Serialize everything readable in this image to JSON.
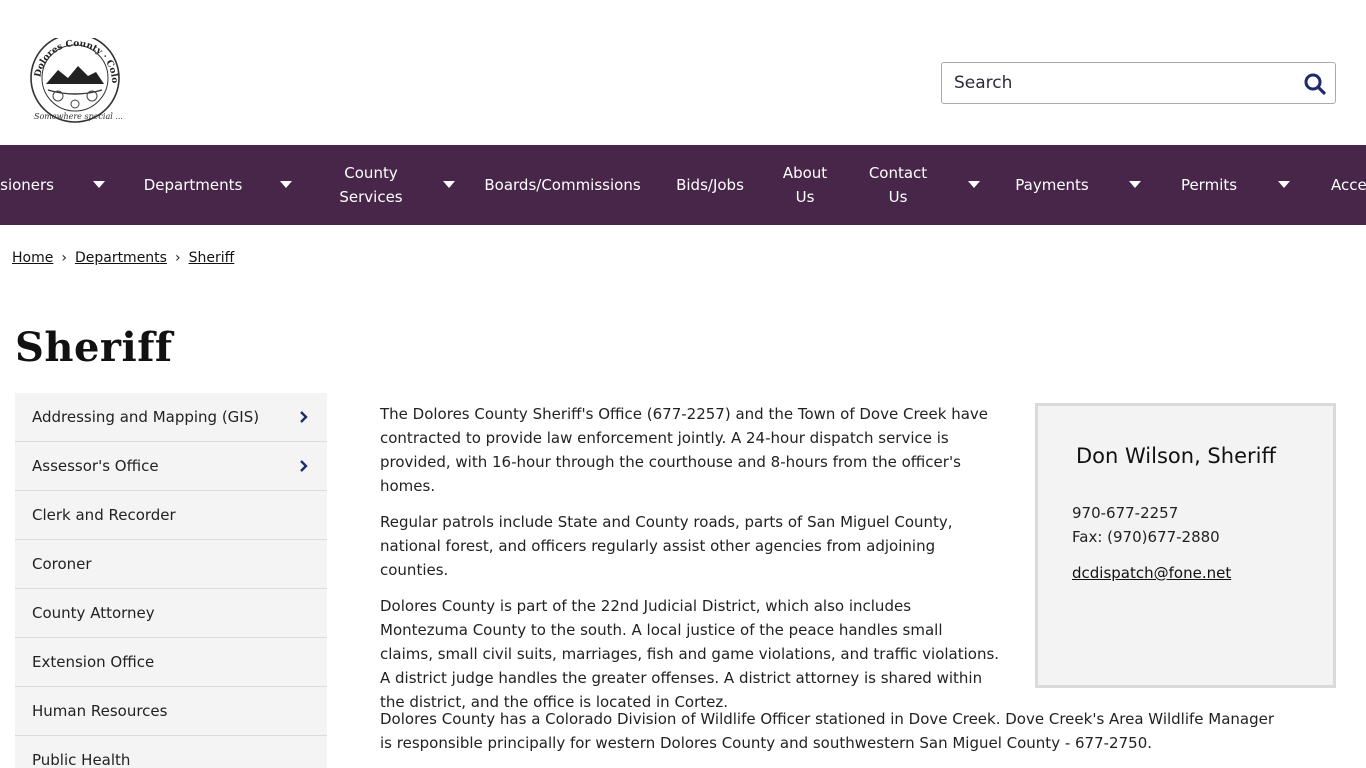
{
  "logo": {
    "seal_text": "Dolores County · Colorado",
    "tagline": "Somewhere special ..."
  },
  "search": {
    "placeholder": "Search",
    "icon": "magnifier-icon"
  },
  "nav": {
    "items": [
      {
        "label": "Commissioners",
        "has_dropdown": true
      },
      {
        "label": "Departments",
        "has_dropdown": true
      },
      {
        "label": "County Services",
        "has_dropdown": true
      },
      {
        "label": "Boards/Commissions",
        "has_dropdown": false
      },
      {
        "label": "Bids/Jobs",
        "has_dropdown": false
      },
      {
        "label": "About Us",
        "has_dropdown": false
      },
      {
        "label": "Contact Us",
        "has_dropdown": true
      },
      {
        "label": "Payments",
        "has_dropdown": true
      },
      {
        "label": "Permits",
        "has_dropdown": true
      },
      {
        "label": "Accessibility",
        "has_dropdown": false
      }
    ]
  },
  "breadcrumb": [
    "Home",
    "Departments",
    "Sheriff"
  ],
  "page_title": "Sheriff",
  "sidebar": {
    "items": [
      {
        "label": "Addressing and Mapping (GIS)",
        "has_children": true
      },
      {
        "label": "Assessor's Office",
        "has_children": true
      },
      {
        "label": "Clerk and Recorder",
        "has_children": false
      },
      {
        "label": "Coroner",
        "has_children": false
      },
      {
        "label": "County Attorney",
        "has_children": false
      },
      {
        "label": "Extension Office",
        "has_children": false
      },
      {
        "label": "Human Resources",
        "has_children": false
      },
      {
        "label": "Public Health",
        "has_children": false
      }
    ]
  },
  "content": {
    "paragraphs": [
      "The Dolores County Sheriff's Office (677-2257) and the Town of Dove Creek have contracted to provide law enforcement jointly. A 24-hour dispatch service is provided, with 16-hour through the courthouse and 8-hours from the officer's homes.",
      "Regular patrols include State and County roads, parts of San Miguel County, national forest, and officers regularly assist other agencies from adjoining counties.",
      "Dolores County is part of the 22nd Judicial District, which also includes Montezuma County to the south. A local justice of the peace handles small claims, small civil suits, marriages, fish and game violations, and traffic violations. A district judge handles the greater offenses. A district attorney is shared within the district, and the office is located in Cortez."
    ],
    "wildlife": "Dolores County has a Colorado Division of Wildlife Officer stationed in Dove Creek. Dove Creek's Area Wildlife Manager is responsible principally for western Dolores County and southwestern San Miguel County - 677-2750."
  },
  "contact": {
    "name": "Don Wilson, Sheriff",
    "phone": "970-677-2257",
    "fax": "Fax: (970)677-2880",
    "email": "dcdispatch@fone.net"
  },
  "colors": {
    "nav_bg": "#48264a",
    "sidebar_bg": "#f4f4f5",
    "card_bg": "#f3f3f3",
    "search_icon": "#1f2a6b"
  }
}
